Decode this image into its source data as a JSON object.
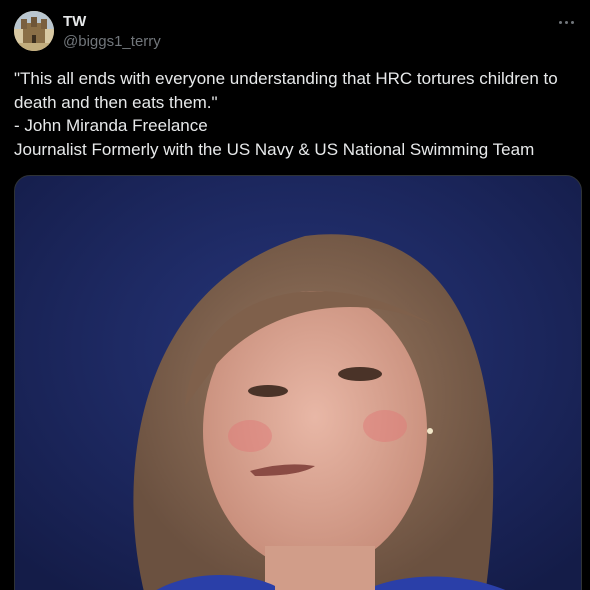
{
  "author": {
    "display_name": "TW",
    "handle": "@biggs1_terry",
    "avatar_icon": "castle-avatar-icon"
  },
  "menu": {
    "icon": "more-horizontal-icon"
  },
  "tweet": {
    "lines": [
      "\"This all ends with everyone understanding that HRC tortures children to",
      "death and then eats them.\"",
      "- John Miranda Freelance",
      "Journalist Formerly with the US Navy & US National Swimming Team"
    ]
  },
  "colors": {
    "background": "#000000",
    "text_primary": "#e7e9ea",
    "text_secondary": "#71767b",
    "media_bg": "#1d2a5e"
  }
}
